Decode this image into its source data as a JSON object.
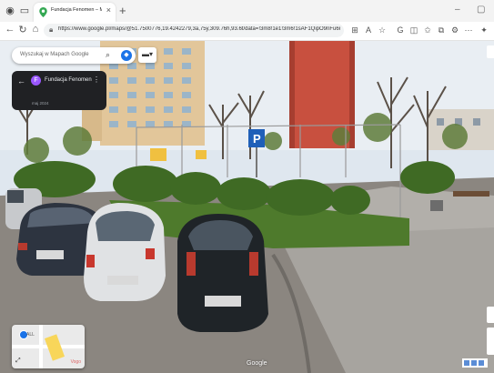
{
  "browser": {
    "tab_title": "Fundacja Fenomen – Mapy Googl",
    "tab_close_icon": "×",
    "new_tab_icon": "+",
    "url": "https://www.google.pl/maps/@51.7500776,19.4242279,3a,75y,309.76h,93.6t/data=!3m8!1e1!3m6!1sAF1QipO9nFu6rFbsNn2X78TrutWNQbZ8O8Qg...",
    "minimize_icon": "–",
    "restore_icon": "▢"
  },
  "maps": {
    "search_placeholder": "Wyszukaj w Mapach Google",
    "place_name": "Fundacja Fenomen",
    "capture_date": "maj 2024",
    "minimap_label": "ALL",
    "attribution": "Google"
  },
  "colors": {
    "sky": "#dfe7ef",
    "apartment_red": "#c8503f",
    "apartment_beige": "#e2c69a",
    "grass": "#4e7a2c",
    "pavement": "#8b8680",
    "info_panel": "#202124",
    "accent": "#1a73e8"
  }
}
